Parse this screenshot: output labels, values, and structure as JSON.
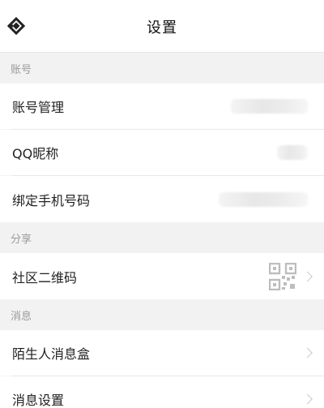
{
  "header": {
    "title": "设置",
    "back_icon": "logo-back-icon"
  },
  "sections": [
    {
      "title": "账号",
      "items": [
        {
          "label": "账号管理",
          "value_state": "blurred"
        },
        {
          "label": "QQ昵称",
          "value_state": "blurred"
        },
        {
          "label": "绑定手机号码",
          "value_state": "blurred"
        }
      ]
    },
    {
      "title": "分享",
      "items": [
        {
          "label": "社区二维码",
          "icon": "qr-code-icon",
          "has_chevron": true
        }
      ]
    },
    {
      "title": "消息",
      "items": [
        {
          "label": "陌生人消息盒",
          "has_chevron": true
        },
        {
          "label": "消息设置",
          "has_chevron": true
        }
      ]
    }
  ],
  "colors": {
    "background": "#f4f4f4",
    "row_background": "#ffffff",
    "section_text": "#9a9a9a",
    "divider": "#e7e7e7"
  }
}
